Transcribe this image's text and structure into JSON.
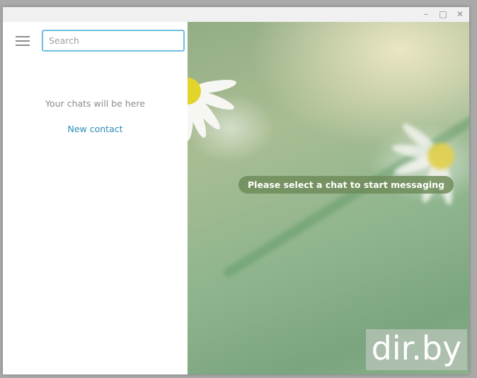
{
  "window": {
    "controls": {
      "minimize": "–",
      "maximize": "□",
      "close": "✕"
    }
  },
  "sidebar": {
    "search_placeholder": "Search",
    "empty_text": "Your chats will be here",
    "new_contact_label": "New contact"
  },
  "chat": {
    "notice": "Please select a chat to start messaging"
  },
  "watermark": "dir.by",
  "colors": {
    "accent": "#2a8bb8",
    "search_border": "#6fbfe3"
  }
}
